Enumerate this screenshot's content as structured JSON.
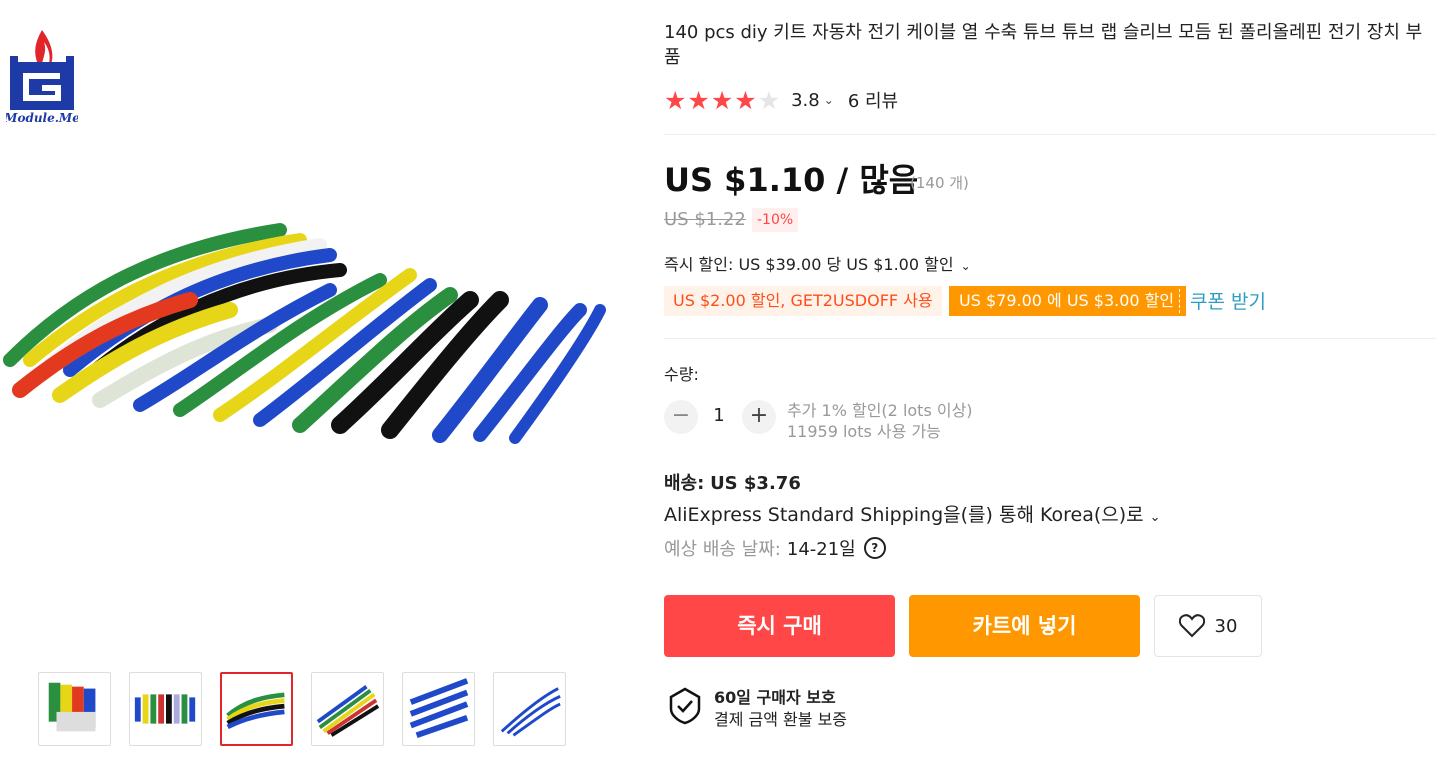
{
  "brand": {
    "logo_text": "Module.Me"
  },
  "product": {
    "title": "140 pcs diy 키트 자동차 전기 케이블 열 수축 튜브 튜브 랩 슬리브 모듬 된 폴리올레핀 전기 장치 부품",
    "rating_value": "3.8",
    "rating_stars": 3.8,
    "reviews": "6 리뷰"
  },
  "price": {
    "main": "US $1.10 / 많음",
    "count": "(140 개)",
    "old": "US $1.22",
    "discount": "-10%"
  },
  "promo": {
    "instant_discount": "즉시 할인: US $39.00 당 US $1.00 할인",
    "coupon1": "US $2.00 할인, GET2USDOFF 사용",
    "coupon2": "US $79.00 에 US $3.00 할인",
    "coupon_link": "쿠폰 받기"
  },
  "quantity": {
    "label": "수량:",
    "value": "1",
    "note1": "추가 1% 할인(2 lots 이상)",
    "note2": "11959 lots 사용 가능"
  },
  "shipping": {
    "price_label": "배송:",
    "price_value": "US $3.76",
    "method": "AliExpress Standard Shipping을(를) 통해 Korea(으)로",
    "date_label": "예상 배송 날짜:",
    "date_value": "14-21일"
  },
  "actions": {
    "buy": "즉시 구매",
    "cart": "카트에 넣기",
    "wish_count": "30"
  },
  "protection": {
    "title": "60일 구매자 보호",
    "subtitle": "결제 금액 환불 보증"
  },
  "colors": {
    "accent": "#ff4747",
    "orange": "#ff9800",
    "link": "#2e9cc3"
  }
}
